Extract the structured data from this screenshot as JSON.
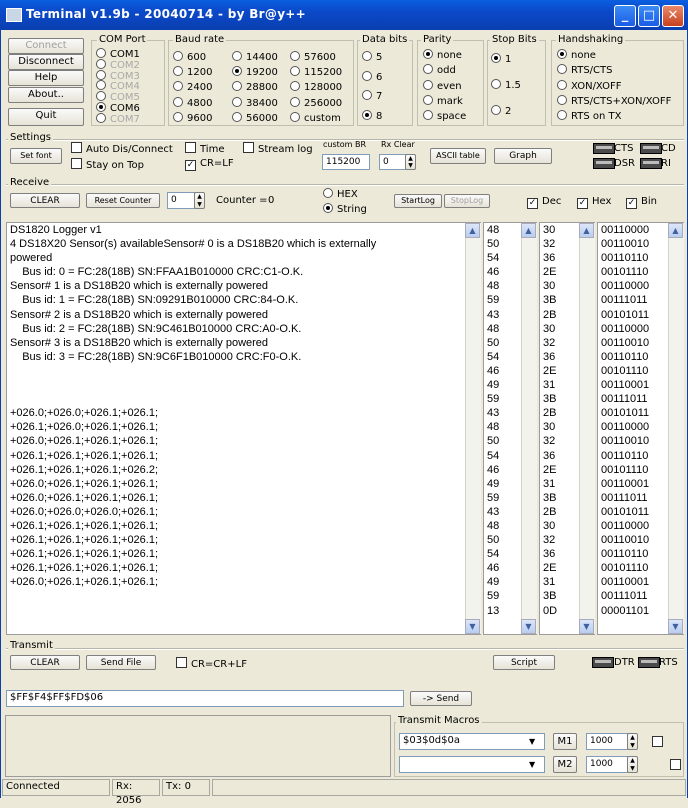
{
  "window": {
    "title": "Terminal v1.9b - 20040714 - by Br@y++"
  },
  "controls": {
    "connect": "Connect",
    "disconnect": "Disconnect",
    "help": "Help",
    "about": "About..",
    "quit": "Quit"
  },
  "com_port": {
    "title": "COM Port",
    "options": [
      "COM1",
      "COM2",
      "COM3",
      "COM4",
      "COM5",
      "COM6",
      "COM7"
    ],
    "selected": "COM6"
  },
  "baud_rate": {
    "title": "Baud rate",
    "col1": [
      "600",
      "1200",
      "2400",
      "4800",
      "9600"
    ],
    "col2": [
      "14400",
      "19200",
      "28800",
      "38400",
      "56000"
    ],
    "col3": [
      "57600",
      "115200",
      "128000",
      "256000",
      "custom"
    ],
    "selected": "19200"
  },
  "data_bits": {
    "title": "Data bits",
    "options": [
      "5",
      "6",
      "7",
      "8"
    ],
    "selected": "8"
  },
  "parity": {
    "title": "Parity",
    "options": [
      "none",
      "odd",
      "even",
      "mark",
      "space"
    ],
    "selected": "none"
  },
  "stop_bits": {
    "title": "Stop Bits",
    "options": [
      "1",
      "1.5",
      "2"
    ],
    "selected": "1"
  },
  "handshaking": {
    "title": "Handshaking",
    "options": [
      "none",
      "RTS/CTS",
      "XON/XOFF",
      "RTS/CTS+XON/XOFF",
      "RTS on TX"
    ],
    "selected": "none"
  },
  "settings": {
    "title": "Settings",
    "set_font": "Set font",
    "auto_dis_connect": "Auto Dis/Connect",
    "stay_on_top": "Stay on Top",
    "time": "Time",
    "cr_lf": "CR=LF",
    "stream_log": "Stream log",
    "custom_br_label": "custom BR",
    "custom_br_value": "115200",
    "rx_clear_label": "Rx Clear",
    "rx_clear_value": "0",
    "ascii_table": "ASCII table",
    "graph": "Graph",
    "cts": "CTS",
    "cd": "CD",
    "dsr": "DSR",
    "ri": "RI"
  },
  "receive": {
    "title": "Receive",
    "clear": "CLEAR",
    "reset_counter": "Reset Counter",
    "counter_spin": "0",
    "counter_label": "Counter =",
    "counter_value": "0",
    "hex": "HEX",
    "string": "String",
    "start_log": "StartLog",
    "stop_log": "StopLog",
    "dec": "Dec",
    "hex_chk": "Hex",
    "bin": "Bin"
  },
  "terminal_lines": [
    "DS1820 Logger v1",
    "4 DS18X20 Sensor(s) availableSensor# 0 is a DS18B20 which is externally",
    "powered",
    "    Bus id: 0 = FC:28(18B) SN:FFAA1B010000 CRC:C1-O.K.",
    "Sensor# 1 is a DS18B20 which is externally powered",
    "    Bus id: 1 = FC:28(18B) SN:09291B010000 CRC:84-O.K.",
    "Sensor# 2 is a DS18B20 which is externally powered",
    "    Bus id: 2 = FC:28(18B) SN:9C461B010000 CRC:A0-O.K.",
    "Sensor# 3 is a DS18B20 which is externally powered",
    "    Bus id: 3 = FC:28(18B) SN:9C6F1B010000 CRC:F0-O.K.",
    "",
    "",
    "",
    "+026.0;+026.0;+026.1;+026.1;",
    "+026.1;+026.0;+026.1;+026.1;",
    "+026.0;+026.1;+026.1;+026.1;",
    "+026.1;+026.1;+026.1;+026.1;",
    "+026.1;+026.1;+026.1;+026.2;",
    "+026.0;+026.1;+026.1;+026.1;",
    "+026.0;+026.1;+026.1;+026.1;",
    "+026.0;+026.0;+026.0;+026.1;",
    "+026.1;+026.1;+026.1;+026.1;",
    "+026.1;+026.1;+026.1;+026.1;",
    "+026.1;+026.1;+026.1;+026.1;",
    "+026.1;+026.1;+026.1;+026.1;",
    "+026.0;+026.1;+026.1;+026.1;"
  ],
  "dec_column": [
    "48",
    "50",
    "54",
    "46",
    "48",
    "59",
    "43",
    "48",
    "50",
    "54",
    "46",
    "49",
    "59",
    "43",
    "48",
    "50",
    "54",
    "46",
    "49",
    "59",
    "43",
    "48",
    "50",
    "54",
    "46",
    "49",
    "59",
    "13"
  ],
  "hex_column": [
    "30",
    "32",
    "36",
    "2E",
    "30",
    "3B",
    "2B",
    "30",
    "32",
    "36",
    "2E",
    "31",
    "3B",
    "2B",
    "30",
    "32",
    "36",
    "2E",
    "31",
    "3B",
    "2B",
    "30",
    "32",
    "36",
    "2E",
    "31",
    "3B",
    "0D"
  ],
  "bin_column": [
    "00110000",
    "00110010",
    "00110110",
    "00101110",
    "00110000",
    "00111011",
    "00101011",
    "00110000",
    "00110010",
    "00110110",
    "00101110",
    "00110001",
    "00111011",
    "00101011",
    "00110000",
    "00110010",
    "00110110",
    "00101110",
    "00110001",
    "00111011",
    "00101011",
    "00110000",
    "00110010",
    "00110110",
    "00101110",
    "00110001",
    "00111011",
    "00001101"
  ],
  "transmit": {
    "title": "Transmit",
    "clear": "CLEAR",
    "send_file": "Send File",
    "cr_crlf": "CR=CR+LF",
    "script": "Script",
    "dtr": "DTR",
    "rts": "RTS",
    "input_value": "$FF$F4$FF$FD$06",
    "send": "-> Send"
  },
  "macros": {
    "title": "Transmit Macros",
    "m1_value": "$03$0d$0a",
    "m1": "M1",
    "m1_interval": "1000",
    "m2_value": "",
    "m2": "M2",
    "m2_interval": "1000"
  },
  "status": {
    "connection": "Connected",
    "rx": "Rx: 2056",
    "tx": "Tx: 0"
  }
}
